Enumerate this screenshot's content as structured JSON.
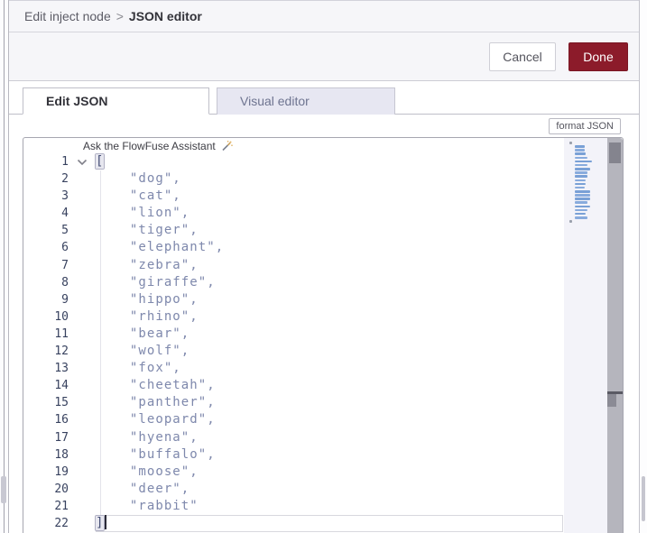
{
  "breadcrumb": {
    "section": "Edit inject node",
    "separator": ">",
    "page": "JSON editor"
  },
  "buttons": {
    "cancel": "Cancel",
    "done": "Done",
    "format": "format JSON"
  },
  "tabs": [
    {
      "label": "Edit JSON",
      "active": true
    },
    {
      "label": "Visual editor",
      "active": false
    }
  ],
  "assistant": {
    "label": "Ask the FlowFuse Assistant",
    "icon": "magic-wand-icon"
  },
  "editor": {
    "language": "json",
    "lines": [
      {
        "num": 1,
        "text": "[",
        "type": "bracket",
        "fold": true,
        "bracketMatch": true
      },
      {
        "num": 2,
        "text": "    \"dog\","
      },
      {
        "num": 3,
        "text": "    \"cat\","
      },
      {
        "num": 4,
        "text": "    \"lion\","
      },
      {
        "num": 5,
        "text": "    \"tiger\","
      },
      {
        "num": 6,
        "text": "    \"elephant\","
      },
      {
        "num": 7,
        "text": "    \"zebra\","
      },
      {
        "num": 8,
        "text": "    \"giraffe\","
      },
      {
        "num": 9,
        "text": "    \"hippo\","
      },
      {
        "num": 10,
        "text": "    \"rhino\","
      },
      {
        "num": 11,
        "text": "    \"bear\","
      },
      {
        "num": 12,
        "text": "    \"wolf\","
      },
      {
        "num": 13,
        "text": "    \"fox\","
      },
      {
        "num": 14,
        "text": "    \"cheetah\","
      },
      {
        "num": 15,
        "text": "    \"panther\","
      },
      {
        "num": 16,
        "text": "    \"leopard\","
      },
      {
        "num": 17,
        "text": "    \"hyena\","
      },
      {
        "num": 18,
        "text": "    \"buffalo\","
      },
      {
        "num": 19,
        "text": "    \"moose\","
      },
      {
        "num": 20,
        "text": "    \"deer\","
      },
      {
        "num": 21,
        "text": "    \"rabbit\""
      },
      {
        "num": 22,
        "text": "]",
        "type": "bracket",
        "bracketMatch": true,
        "cursor": true,
        "currentLine": true
      }
    ]
  },
  "colors": {
    "accent_red": "#8c1b2a",
    "string_token": "#7e88ac",
    "bracket_token": "#454f76",
    "line_number": "#38425f",
    "minimap_mark_a": "#88abdd",
    "minimap_mark_b": "#79a0d6",
    "minimap_mark_bracket": "#9aa0ac"
  }
}
